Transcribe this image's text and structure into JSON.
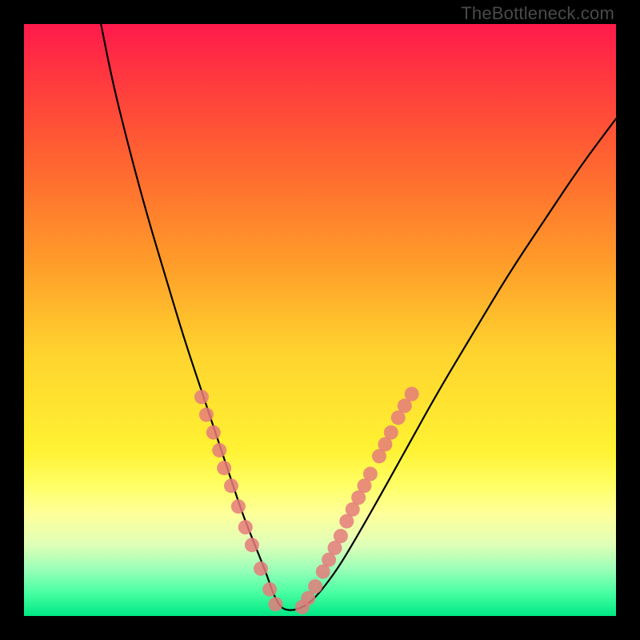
{
  "watermark": "TheBottleneck.com",
  "chart_data": {
    "type": "line",
    "title": "",
    "xlabel": "",
    "ylabel": "",
    "xlim": [
      0,
      100
    ],
    "ylim": [
      0,
      100
    ],
    "grid": false,
    "legend": false,
    "background_gradient": {
      "top": "#ff1a4b",
      "mid": "#fff233",
      "bottom": "#00e884"
    },
    "series": [
      {
        "name": "bottleneck-curve",
        "color": "#000000",
        "x": [
          13,
          15,
          18,
          21,
          24,
          27,
          30,
          33,
          35,
          37,
          39,
          41,
          42,
          43,
          44,
          46,
          48,
          50,
          53,
          56,
          60,
          65,
          70,
          76,
          82,
          88,
          94,
          100
        ],
        "y": [
          100,
          90,
          78,
          67,
          57,
          47,
          38,
          29,
          23,
          17,
          12,
          7,
          4,
          2,
          1,
          1,
          2,
          4,
          8,
          13,
          20,
          29,
          38,
          48,
          58,
          67,
          76,
          84
        ]
      },
      {
        "name": "highlight-dots-left",
        "type": "scatter",
        "color": "#e57b7b",
        "x": [
          30,
          30.8,
          32,
          33,
          33.8,
          35,
          36.2,
          37.4,
          38.5,
          40,
          41.5,
          42.5
        ],
        "y": [
          37,
          34,
          31,
          28,
          25,
          22,
          18.5,
          15,
          12,
          8,
          4.5,
          2
        ]
      },
      {
        "name": "highlight-dots-right",
        "type": "scatter",
        "color": "#e57b7b",
        "x": [
          47,
          48,
          49.2,
          50.5,
          51.5,
          52.5,
          53.5,
          54.5,
          55.5,
          56.5,
          57.5,
          58.5,
          60,
          61,
          62,
          63.2,
          64.3,
          65.5
        ],
        "y": [
          1.5,
          3,
          5,
          7.5,
          9.5,
          11.5,
          13.5,
          16,
          18,
          20,
          22,
          24,
          27,
          29,
          31,
          33.5,
          35.5,
          37.5
        ]
      }
    ],
    "annotations": []
  },
  "colors": {
    "frame": "#000000",
    "curve": "#000000",
    "dots": "#e57b7b"
  }
}
